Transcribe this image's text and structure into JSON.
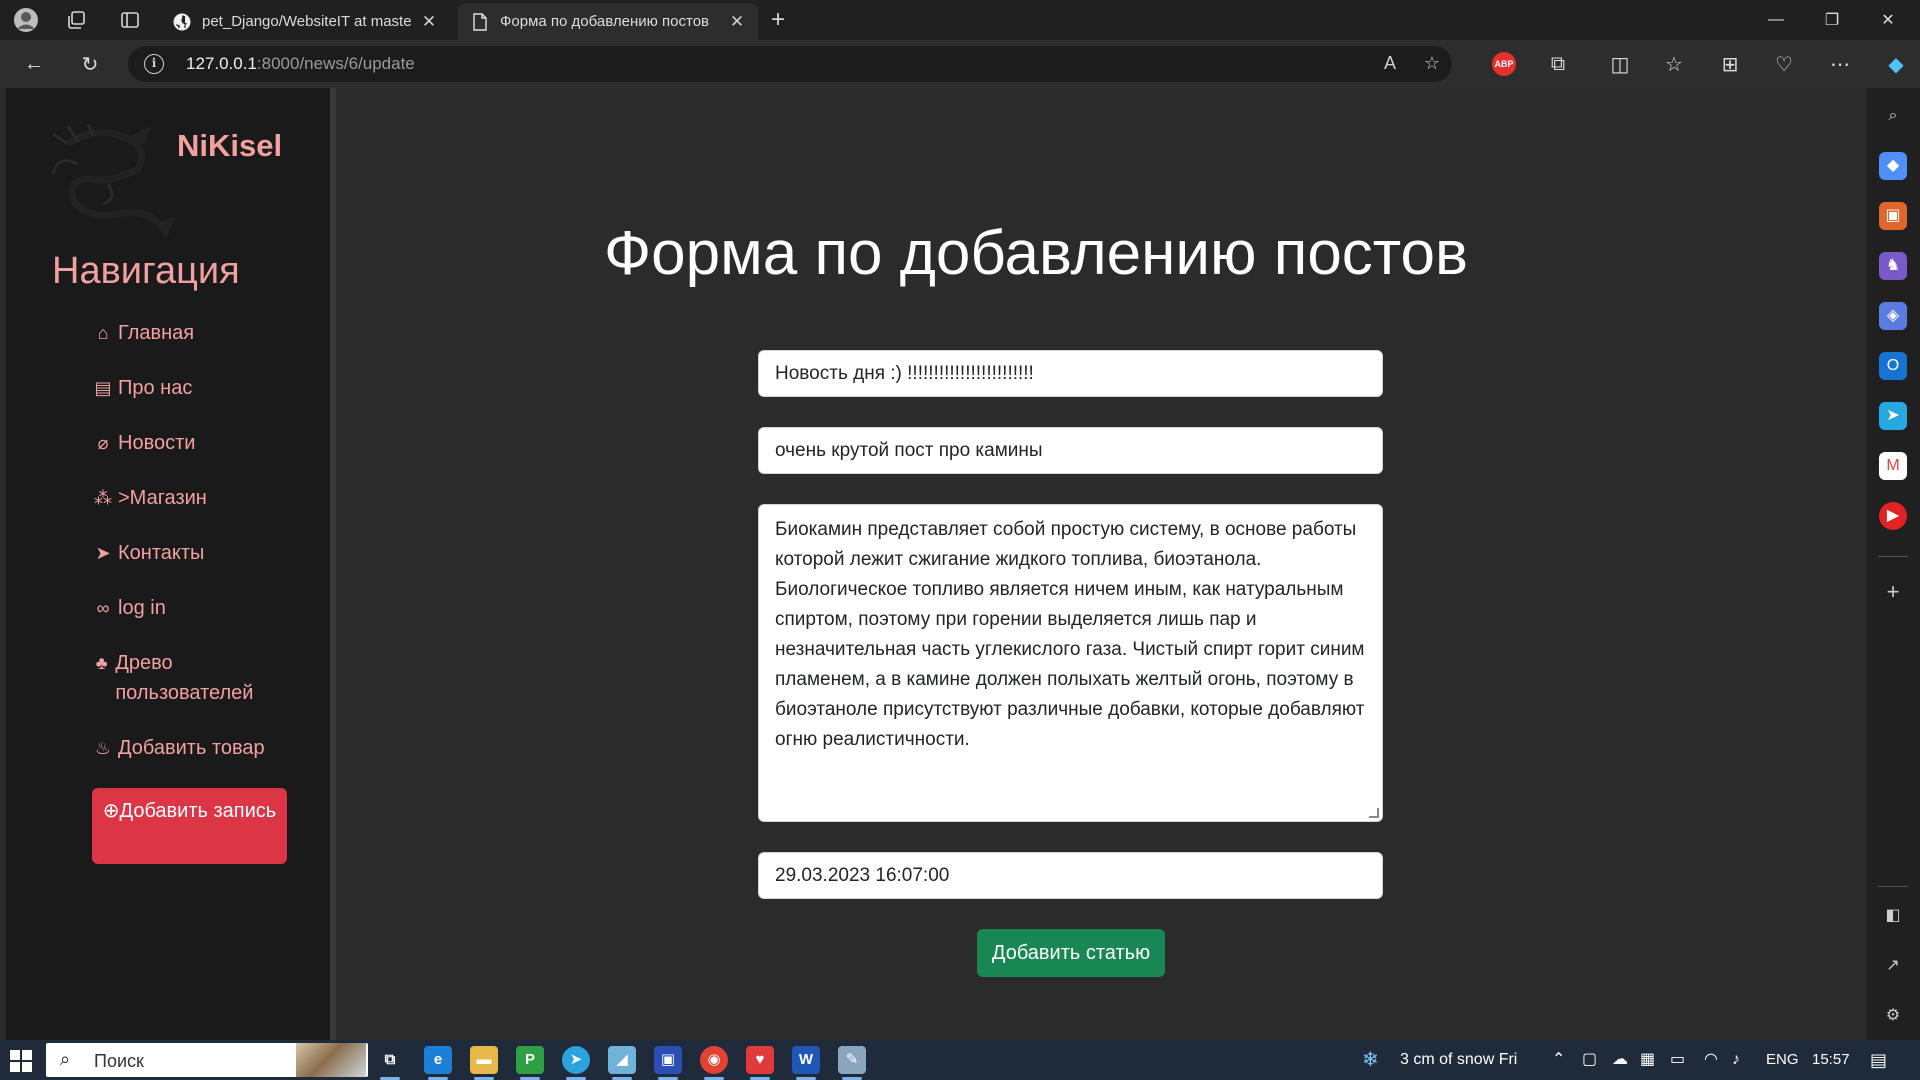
{
  "browser": {
    "tabs": [
      {
        "title": "pet_Django/WebsiteIT at master",
        "favicon": "github-icon",
        "active": false
      },
      {
        "title": "Форма по добавлению постов",
        "favicon": "page-icon",
        "active": true
      }
    ],
    "address": {
      "host": "127.0.0.1",
      "path": ":8000/news/6/update"
    },
    "abp_label": "ABP"
  },
  "sidebar": {
    "brand": "NiKisel",
    "heading": "Навигация",
    "items": [
      {
        "icon": "home-icon",
        "label": "Главная"
      },
      {
        "icon": "id-card-icon",
        "label": "Про нас"
      },
      {
        "icon": "paperclip-icon",
        "label": "Новости"
      },
      {
        "icon": "cubes-icon",
        "label": ">Магазин"
      },
      {
        "icon": "paper-plane-icon",
        "label": "Контакты"
      },
      {
        "icon": "shoe-prints-icon",
        "label": "log in"
      },
      {
        "icon": "tree-icon",
        "label": "Древо пользователей"
      },
      {
        "icon": "fire-icon",
        "label": "Добавить товар"
      }
    ],
    "add_button": "Добавить запись"
  },
  "main": {
    "title": "Форма по добавлению постов",
    "fields": {
      "title_value": "Новость дня :) !!!!!!!!!!!!!!!!!!!!!!!!",
      "anons_value": "очень крутой пост про камины",
      "full_text": "Биокамин представляет собой простую систему, в основе работы которой лежит сжигание жидкого топлива, биоэтанола. Биологическое топливо является ничем иным, как натуральным спиртом, поэтому при горении выделяется лишь пар и незначительная часть углекислого газа. Чистый спирт горит синим пламенем, а в камине должен полыхать желтый огонь, поэтому в биоэтаноле присутствуют различные добавки, которые добавляют огню реалистичности.",
      "date_value": "29.03.2023 16:07:00"
    },
    "submit_label": "Добавить статью"
  },
  "taskbar": {
    "search_label": "Поиск",
    "weather": "3 cm of snow Fri",
    "language": "ENG",
    "time": "15:57"
  },
  "colors": {
    "accent_pink": "#f2a0a0",
    "danger": "#dc3545",
    "success": "#198754",
    "page_bg": "#2b2b2b",
    "sidebar_bg": "#1a1a1a"
  }
}
